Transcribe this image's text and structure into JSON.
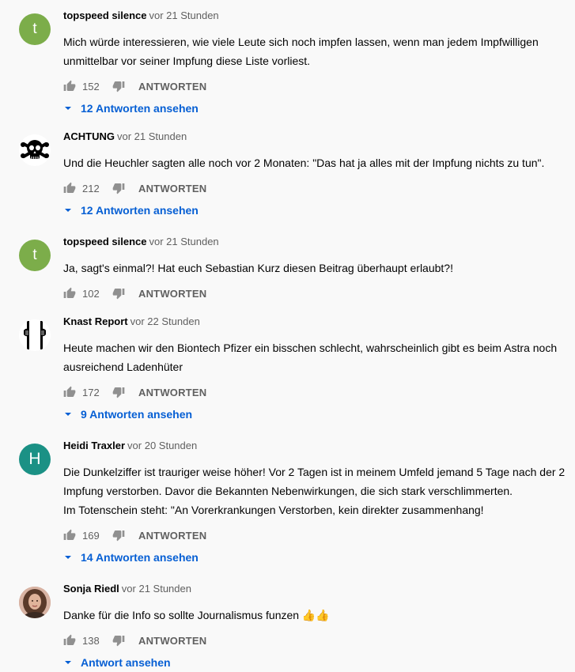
{
  "comments": [
    {
      "author": "topspeed silence",
      "time": "vor 21 Stunden",
      "avatar": {
        "type": "letter",
        "letter": "t",
        "color": "#7cad4a"
      },
      "lines": [
        "Mich würde interessieren, wie viele Leute sich noch impfen lassen, wenn man jedem Impfwilligen",
        "unmittelbar vor seiner Impfung diese Liste vorliest."
      ],
      "likes": "152",
      "reply_label": "ANTWORTEN",
      "replies_label": "12 Antworten ansehen"
    },
    {
      "author": "ACHTUNG",
      "time": "vor 21 Stunden",
      "avatar": {
        "type": "skull-icon"
      },
      "lines": [
        "Und die Heuchler sagten alle noch vor 2 Monaten: \"Das hat ja alles mit der Impfung nichts zu tun\"."
      ],
      "likes": "212",
      "reply_label": "ANTWORTEN",
      "replies_label": "12 Antworten ansehen"
    },
    {
      "author": "topspeed silence",
      "time": "vor 21 Stunden",
      "avatar": {
        "type": "letter",
        "letter": "t",
        "color": "#7cad4a"
      },
      "lines": [
        "Ja, sagt's einmal?! Hat euch Sebastian Kurz diesen Beitrag überhaupt erlaubt?!"
      ],
      "likes": "102",
      "reply_label": "ANTWORTEN"
    },
    {
      "author": "Knast Report",
      "time": "vor 22 Stunden",
      "avatar": {
        "type": "prison-bars-icon"
      },
      "lines": [
        "Heute machen wir den Biontech Pfizer ein bisschen schlecht, wahrscheinlich gibt es beim Astra noch",
        "ausreichend Ladenhüter"
      ],
      "likes": "172",
      "reply_label": "ANTWORTEN",
      "replies_label": "9 Antworten ansehen"
    },
    {
      "author": "Heidi Traxler",
      "time": "vor 20 Stunden",
      "avatar": {
        "type": "letter",
        "letter": "H",
        "color": "#1b9185"
      },
      "lines": [
        "Die Dunkelziffer ist trauriger weise höher! Vor 2 Tagen ist in meinem Umfeld jemand 5 Tage nach der 2",
        "Impfung verstorben. Davor die Bekannten Nebenwirkungen, die sich stark verschlimmerten.",
        "Im Totenschein steht: \"An Vorerkrankungen Verstorben, kein direkter zusammenhang!"
      ],
      "likes": "169",
      "reply_label": "ANTWORTEN",
      "replies_label": "14 Antworten ansehen"
    },
    {
      "author": "Sonja Riedl",
      "time": "vor 21 Stunden",
      "avatar": {
        "type": "photo"
      },
      "lines": [
        "Danke für die Info so sollte Journalismus funzen 👍👍"
      ],
      "likes": "138",
      "reply_label": "ANTWORTEN",
      "replies_label": "Antwort ansehen"
    }
  ],
  "icons": {
    "like": "thumb-up-icon",
    "dislike": "thumb-down-icon",
    "expand": "chevron-down-icon"
  },
  "colors": {
    "link": "#065fd4",
    "meta": "#606060",
    "background": "#f9f9f9"
  }
}
